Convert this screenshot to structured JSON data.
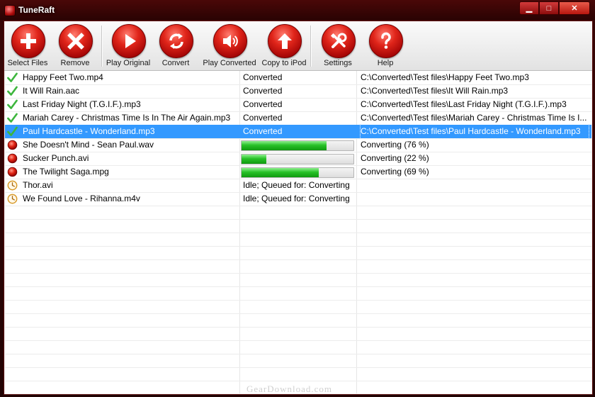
{
  "window": {
    "title": "TuneRaft"
  },
  "window_controls": {
    "minimize": "▁",
    "maximize": "□",
    "close": "✕"
  },
  "toolbar": {
    "buttons": [
      {
        "label": "Select Files",
        "icon": "plus-icon"
      },
      {
        "label": "Remove",
        "icon": "x-icon"
      },
      {
        "label": "Play Original",
        "icon": "play-icon"
      },
      {
        "label": "Convert",
        "icon": "refresh-icon"
      },
      {
        "label": "Play Converted",
        "icon": "speaker-icon"
      },
      {
        "label": "Copy to iPod",
        "icon": "arrow-up-icon"
      },
      {
        "label": "Settings",
        "icon": "tools-icon"
      },
      {
        "label": "Help",
        "icon": "question-icon"
      }
    ]
  },
  "files": [
    {
      "name": "Happy Feet Two.mp4",
      "state": "done",
      "status": "Converted",
      "output": "C:\\Converted\\Test files\\Happy Feet Two.mp3"
    },
    {
      "name": "It Will Rain.aac",
      "state": "done",
      "status": "Converted",
      "output": "C:\\Converted\\Test files\\It Will Rain.mp3"
    },
    {
      "name": "Last Friday Night (T.G.I.F.).mp3",
      "state": "done",
      "status": "Converted",
      "output": "C:\\Converted\\Test files\\Last Friday Night (T.G.I.F.).mp3"
    },
    {
      "name": "Mariah Carey - Christmas Time Is In The Air Again.mp3",
      "state": "done",
      "status": "Converted",
      "output": "C:\\Converted\\Test files\\Mariah Carey - Christmas Time Is I..."
    },
    {
      "name": "Paul Hardcastle - Wonderland.mp3",
      "state": "done",
      "status": "Converted",
      "output": "C:\\Converted\\Test files\\Paul Hardcastle - Wonderland.mp3",
      "selected": true
    },
    {
      "name": "She Doesn't Mind - Sean Paul.wav",
      "state": "converting",
      "progress": 0.76,
      "output": "Converting (76 %)"
    },
    {
      "name": "Sucker Punch.avi",
      "state": "converting",
      "progress": 0.22,
      "output": "Converting (22 %)"
    },
    {
      "name": "The Twilight Saga.mpg",
      "state": "converting",
      "progress": 0.69,
      "output": "Converting (69 %)"
    },
    {
      "name": "Thor.avi",
      "state": "queued",
      "status": "Idle; Queued for: Converting",
      "output": ""
    },
    {
      "name": "We Found Love - Rihanna.m4v",
      "state": "queued",
      "status": "Idle; Queued for: Converting",
      "output": ""
    }
  ],
  "watermark": "GearDownload.com",
  "colors": {
    "accent": "#c4120c",
    "selection": "#3399ff",
    "progress": "#1fb51f"
  }
}
